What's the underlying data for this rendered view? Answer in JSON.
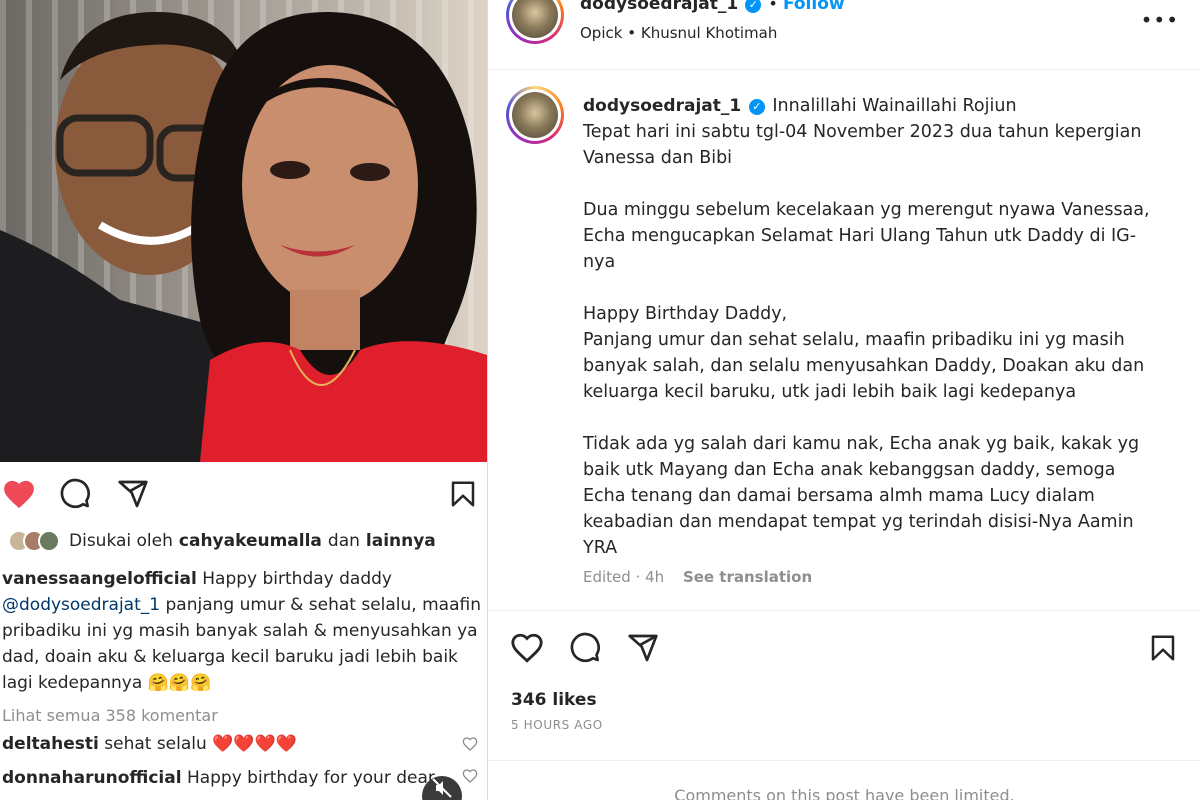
{
  "left_post": {
    "liked_by_prefix": "Disukai oleh",
    "liked_by_user": "cahyakeumalla",
    "liked_by_and": "dan",
    "liked_by_others": "lainnya",
    "caption_user": "vanessaangelofficial",
    "caption_line1": "Happy birthday daddy",
    "caption_mention": "@dodysoedrajat_1",
    "caption_rest": "panjang umur & sehat selalu, maafin pribadiku ini yg masih banyak salah & menyusahkan ya dad, doain aku & keluarga kecil baruku jadi lebih baik lagi kedepannya",
    "caption_emoji": "🤗🤗🤗",
    "view_comments": "Lihat semua 358 komentar",
    "comments": [
      {
        "user": "deltahesti",
        "text": "sehat selalu ❤️❤️❤️❤️"
      },
      {
        "user": "donnaharunofficial",
        "text": "Happy birthday for your dear"
      }
    ]
  },
  "right_post": {
    "username": "dodysoedrajat_1",
    "follow_label": "Follow",
    "song_artist": "Opick",
    "song_separator": "•",
    "song_title": "Khusnul Khotimah",
    "more_label": "•••",
    "verified_glyph": "✓",
    "caption_lines": [
      "Innalillahi Wainaillahi Rojiun",
      "Tepat hari ini sabtu tgl-04 November 2023 dua tahun kepergian",
      "Vanessa dan Bibi",
      "",
      "Dua minggu sebelum kecelakaan yg merengut nyawa Vanessaa,",
      "Echa mengucapkan Selamat Hari Ulang Tahun utk Daddy di IG-",
      "nya",
      "",
      "Happy Birthday Daddy,",
      "Panjang umur dan sehat selalu, maafin pribadiku ini yg masih",
      "banyak salah, dan selalu menyusahkan Daddy, Doakan aku dan",
      "keluarga kecil baruku, utk jadi lebih baik lagi kedepanya",
      "",
      "Tidak ada yg salah dari kamu nak, Echa anak yg baik, kakak yg",
      "baik utk Mayang dan Echa anak kebanggsan daddy, semoga",
      "Echa tenang dan damai bersama almh mama Lucy dialam",
      "keabadian dan mendapat tempat yg terindah disisi-Nya Aamin",
      "YRA"
    ],
    "edited_label": "Edited · 4h",
    "see_translation": "See translation",
    "likes_label": "346 likes",
    "time_ago": "5 HOURS AGO",
    "comments_limited": "Comments on this post have been limited."
  },
  "colors": {
    "heart_red": "#ed4956",
    "link_blue": "#0095f6",
    "mention_blue": "#00376b",
    "muted_gray": "#8e8e8e"
  }
}
